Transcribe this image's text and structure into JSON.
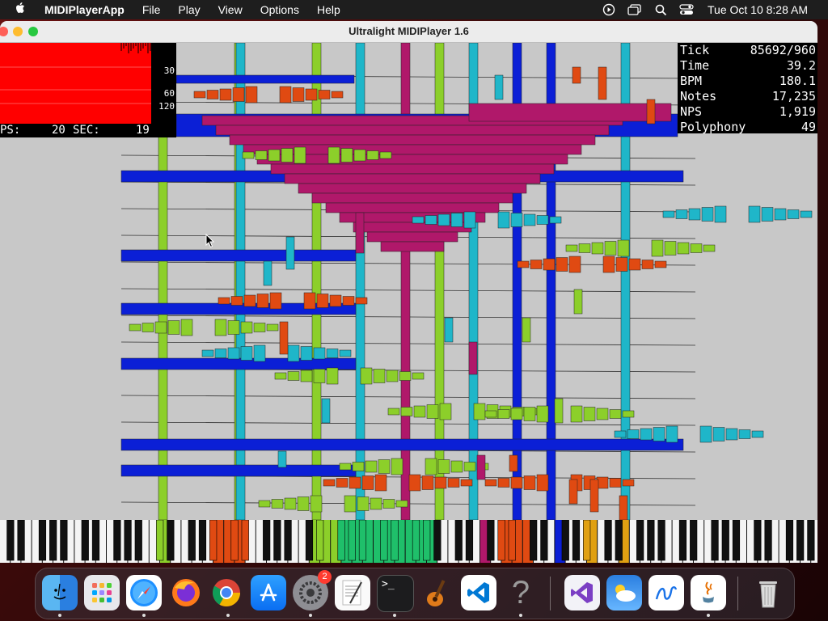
{
  "menubar": {
    "app_name": "MIDIPlayerApp",
    "items": [
      "File",
      "Play",
      "View",
      "Options",
      "Help"
    ],
    "clock": "Tue Oct 10  8:28 AM"
  },
  "window": {
    "title": "Ultralight MIDIPlayer 1.6"
  },
  "graph": {
    "labels": [
      "30",
      "60",
      "120"
    ],
    "fps_label": "PS:",
    "fps_value": "20",
    "sec_label": "SEC:",
    "sec_value": "19"
  },
  "stats": [
    {
      "label": "Tick",
      "value": "85692/960"
    },
    {
      "label": "Time",
      "value": "39.2"
    },
    {
      "label": "BPM",
      "value": "180.1"
    },
    {
      "label": "Notes",
      "value": "17,235"
    },
    {
      "label": "NPS",
      "value": "1,919"
    },
    {
      "label": "Polyphony",
      "value": "49"
    }
  ],
  "dock": {
    "badge_count": "2",
    "apps": [
      "finder",
      "launchpad",
      "safari",
      "firefox",
      "chrome",
      "app-store",
      "system-settings",
      "textedit",
      "terminal",
      "garageband",
      "vscode",
      "help",
      "visual-studio",
      "weather",
      "freeform",
      "java",
      "trash"
    ]
  },
  "colors": {
    "note_blue": "#0b1fd6",
    "note_magenta": "#b0186a",
    "note_green": "#8ccf2a",
    "note_cyan": "#1fb6c9",
    "note_orange": "#e04a12",
    "graph_red": "#ff0000"
  }
}
